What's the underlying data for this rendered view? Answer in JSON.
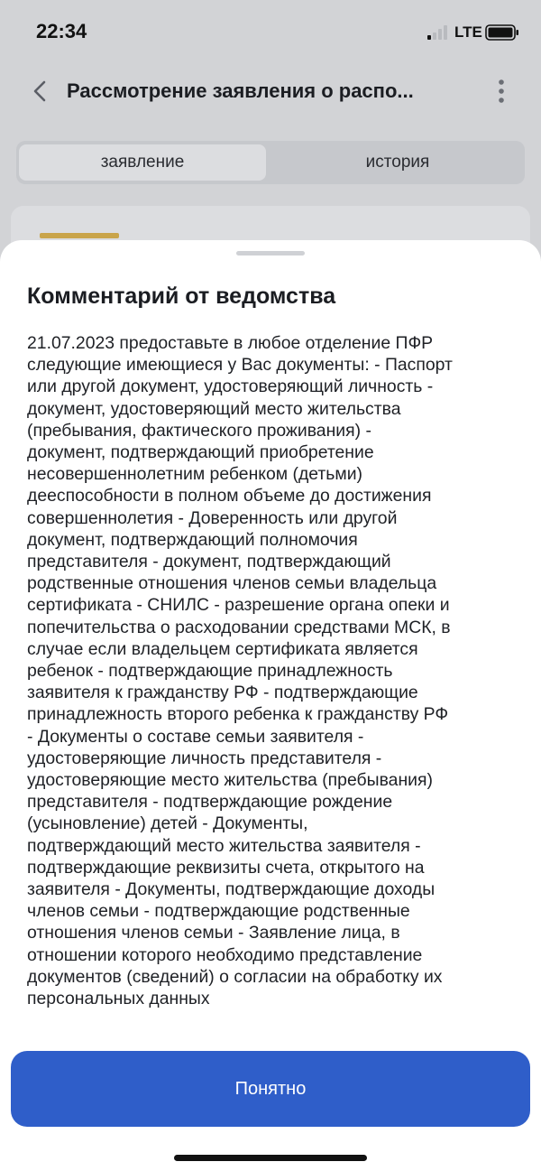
{
  "status_bar": {
    "time": "22:34",
    "network": "LTE",
    "icons": [
      "signal-icon",
      "battery-icon"
    ]
  },
  "header": {
    "title": "Рассмотрение заявления о распо...",
    "icons": [
      "chevron-left-icon",
      "more-vertical-icon"
    ]
  },
  "tabs": [
    {
      "label": "заявление",
      "active": true
    },
    {
      "label": "история",
      "active": false
    }
  ],
  "sheet": {
    "title": "Комментарий от ведомства",
    "lines": [
      "21.07.2023 предоставьте в любое отделение ПФР",
      "следующие имеющиеся у Вас документы: - Паспорт",
      "или другой документ, удостоверяющий личность -",
      "документ, удостоверяющий место жительства",
      "(пребывания, фактического проживания) -",
      "документ, подтверждающий приобретение",
      "несовершеннолетним ребенком (детьми)",
      "дееспособности в полном объеме до достижения",
      "совершеннолетия - Доверенность или другой",
      "документ, подтверждающий полномочия",
      "представителя - документ, подтверждающий",
      "родственные отношения членов семьи владельца",
      "сертификата - СНИЛС - разрешение органа опеки и",
      "попечительства о расходовании средствами МСК, в",
      "случае если владельцем сертификата является",
      "ребенок - подтверждающие принадлежность",
      "заявителя к гражданству РФ - подтверждающие",
      "принадлежность второго ребенка к гражданству РФ",
      "- Документы о составе семьи заявителя -",
      "удостоверяющие личность представителя -",
      "удостоверяющие место жительства (пребывания)",
      "представителя - подтверждающие рождение",
      "(усыновление) детей - Документы,",
      "подтверждающий место жительства заявителя -",
      "подтверждающие реквизиты счета, открытого на",
      "заявителя - Документы, подтверждающие доходы",
      "членов семьи - подтверждающие родственные",
      "отношения членов семьи - Заявление лица, в",
      "отношении которого необходимо представление",
      "документов (сведений) о согласии на обработку их",
      "персональных данных"
    ],
    "button_label": "Понятно"
  },
  "colors": {
    "accent": "#2f5ec9",
    "card_accent": "#c9a44a",
    "overlay": "#d2d3d6"
  }
}
